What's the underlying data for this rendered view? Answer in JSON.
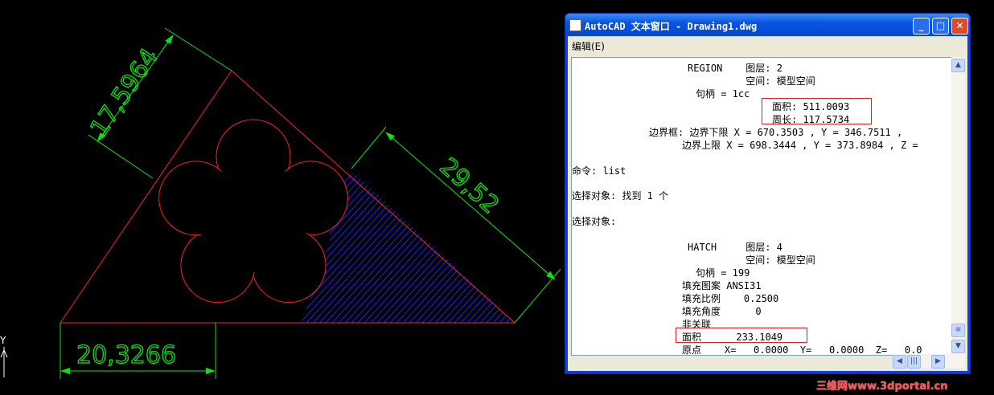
{
  "drawing": {
    "dim_bottom": "20,3266",
    "dim_left": "17,5964",
    "dim_right": "29,52",
    "axis_label": "Y"
  },
  "window": {
    "title": "AutoCAD 文本窗口 - Drawing1.dwg",
    "menu_edit": "编辑(E)",
    "lines": [
      "REGION    图层: 2",
      "          空间: 模型空间",
      "句柄 = 1cc",
      "面积: 511.0093",
      "周长: 117.5734",
      "边界框: 边界下限 X = 670.3503 , Y = 346.7511 ,",
      "边界上限 X = 698.3444 , Y = 373.8984 , Z =",
      "命令: list",
      "选择对象: 找到 1 个",
      "选择对象:",
      "HATCH     图层: 4",
      "          空间: 模型空间",
      "句柄 = 199",
      "填充图案 ANSI31",
      "填充比例    0.2500",
      "填充角度      0",
      "非关联",
      "面积      233.1049",
      "原点    X=   0.0000  Y=   0.0000  Z=   0.0"
    ]
  },
  "watermark": "三维网www.3dportal.cn",
  "colors": {
    "geometry": "#ff2020",
    "dimension": "#10e010",
    "hatch": "#2020ff"
  }
}
